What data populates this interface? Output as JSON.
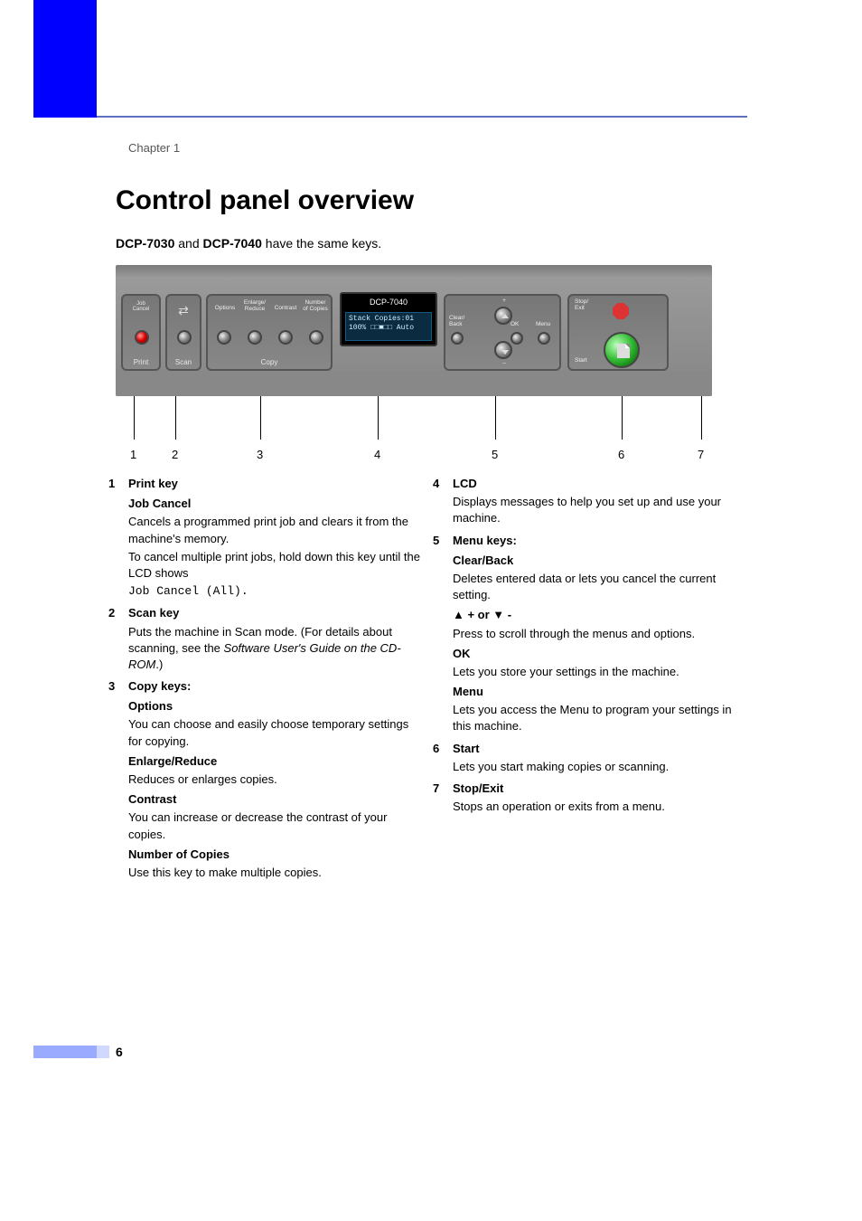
{
  "chapter": "Chapter 1",
  "title": "Control panel overview",
  "subtitle_plain1": "DCP-7030",
  "subtitle_mid": " and ",
  "subtitle_plain2": "DCP-7040",
  "subtitle_end": " have the same keys.",
  "panel": {
    "print_top": "Job\nCancel",
    "print_footer": "Print",
    "scan_footer": "Scan",
    "copy_labels": {
      "options": "Options",
      "enlarge": "Enlarge/\nReduce",
      "contrast": "Contrast",
      "number": "Number\nof Copies"
    },
    "copy_footer": "Copy",
    "lcd_model": "DCP-7040",
    "lcd_line1": "Stack   Copies:01",
    "lcd_line2": "100%  □□■□□ Auto",
    "menu": {
      "clear": "Clear/\nBack",
      "ok": "OK",
      "menu": "Menu",
      "plus": "+",
      "minus": "−"
    },
    "stop": {
      "stop": "Stop/\nExit",
      "start": "Start"
    }
  },
  "callouts": [
    "1",
    "2",
    "3",
    "4",
    "5",
    "6",
    "7"
  ],
  "items": {
    "1": {
      "title": "Print key",
      "sub1_title": "Job Cancel",
      "sub1_p1": "Cancels a programmed print job and clears it from the machine's memory.",
      "sub1_p2": "To cancel multiple print jobs, hold down this key until the LCD shows",
      "sub1_mono": "Job Cancel (All)."
    },
    "2": {
      "title": "Scan key",
      "p_pre": "Puts the machine in Scan mode. (For details about scanning, see the ",
      "p_ital": "Software User's Guide on the CD-ROM",
      "p_post": ".)"
    },
    "3": {
      "title": "Copy keys:",
      "s1t": "Options",
      "s1p": "You can choose and easily choose temporary settings for copying.",
      "s2t": "Enlarge/Reduce",
      "s2p": "Reduces or enlarges copies.",
      "s3t": "Contrast",
      "s3p": "You can increase or decrease the contrast of your copies.",
      "s4t": "Number of Copies",
      "s4p": "Use this key to make multiple copies."
    },
    "4": {
      "title": "LCD",
      "p": "Displays messages to help you set up and use your machine."
    },
    "5": {
      "title": "Menu keys:",
      "s1t": "Clear/Back",
      "s1p": "Deletes entered data or lets you cancel the current setting.",
      "s2t_pre": "▲ + or ▼ -",
      "s2p": "Press to scroll through the menus and options.",
      "s3t": "OK",
      "s3p": "Lets you store your settings in the machine.",
      "s4t": "Menu",
      "s4p": "Lets you access the Menu to program your settings in this machine."
    },
    "6": {
      "title": "Start",
      "p": "Lets you start making copies or scanning."
    },
    "7": {
      "title": "Stop/Exit",
      "p": "Stops an operation or exits from a menu."
    }
  },
  "page_num": "6"
}
